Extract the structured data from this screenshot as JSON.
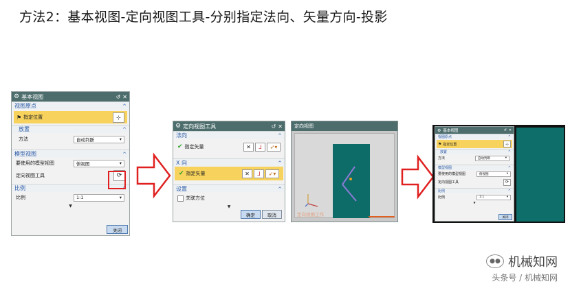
{
  "title": "方法2：基本视图-定向视图工具-分别指定法向、矢量方向-投影",
  "dialog1": {
    "header": "基本视图",
    "sec_origin": "视图原点",
    "specify_position": "指定位置",
    "sec_place": "放置",
    "method_label": "方法",
    "method_value": "自动判断",
    "sec_model_view": "模型视图",
    "model_view_label": "要使用的模型视图",
    "model_view_value": "俯视图",
    "orient_tool_label": "定向视图工具",
    "sec_scale": "比例",
    "scale_label": "比例",
    "scale_value": "1:1",
    "close_label": "关闭"
  },
  "dialog2": {
    "header": "定向视图工具",
    "sec_normal": "法向",
    "specify_vector_1": "指定矢量",
    "sec_x": "X 向",
    "specify_vector_2": "指定矢量",
    "sec_settings": "设置",
    "assoc_orient": "关联方位",
    "ok_label": "确定",
    "cancel_label": "取消"
  },
  "viewport": {
    "header": "定向视图",
    "caption": "定向视图工作"
  },
  "dialog3": {
    "header": "基本视图",
    "sec_origin": "视图原点",
    "specify_position": "指定位置",
    "sec_place": "放置",
    "method_label": "方法",
    "method_value": "自动判断",
    "sec_model_view": "模型视图",
    "model_view_label": "要使用的模型视图",
    "model_view_value": "俯视图",
    "orient_tool_label": "定向视图工具",
    "sec_scale": "比例",
    "scale_label": "比例",
    "scale_value": "1:1",
    "close_label": "关闭"
  },
  "watermark": {
    "main": "机械知网",
    "sub": "头条号 / 机械知网"
  },
  "colors": {
    "header_bg": "#4d6d6d",
    "highlight": "#f7d25c",
    "section_text": "#2a5aa8",
    "model_teal": "#0e6c68",
    "arrow_red": "#e02020",
    "check_green": "#2ca02c"
  }
}
